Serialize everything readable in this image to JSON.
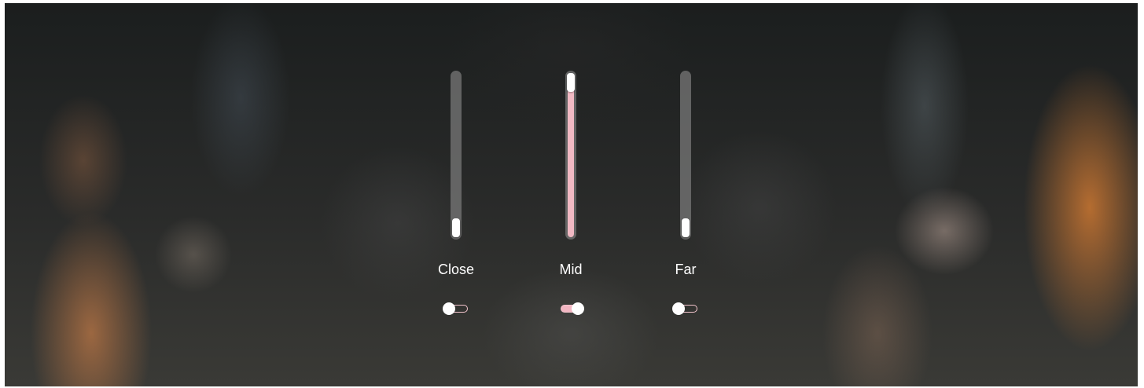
{
  "colors": {
    "accent": "#f1b9c3",
    "track": "#787878",
    "thumb": "#ffffff",
    "label": "#ffffff"
  },
  "channels": [
    {
      "label": "Close",
      "level": 0.0,
      "enabled": false
    },
    {
      "label": "Mid",
      "level": 1.0,
      "enabled": true
    },
    {
      "label": "Far",
      "level": 0.0,
      "enabled": false
    }
  ]
}
